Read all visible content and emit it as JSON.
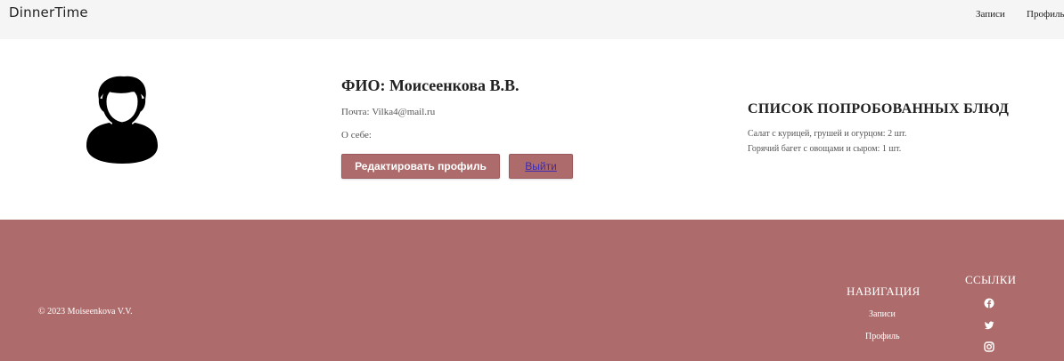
{
  "header": {
    "brand": "DinnerTime",
    "nav": [
      "Записи",
      "Профиль"
    ]
  },
  "profile": {
    "fio": "ФИО: Моисеенкова В.В.",
    "email": "Почта: Vilka4@mail.ru",
    "about": "О себе:",
    "edit_button": "Редактировать профиль",
    "logout_button": "Выйти"
  },
  "dishes": {
    "title": "СПИСОК ПОПРОБОВАННЫХ БЛЮД",
    "items": [
      "Салат с курицей, грушей и огурцом: 2 шт.",
      "Горячий багет с овощами и сыром: 1 шт."
    ]
  },
  "footer": {
    "copyright": "© 2023 Moiseenkova V.V.",
    "nav_title": "НАВИГАЦИЯ",
    "nav_links": [
      "Записи",
      "Профиль"
    ],
    "links_title": "ССЫЛКИ",
    "social_icons": [
      "facebook-icon",
      "twitter-icon",
      "instagram-icon"
    ]
  },
  "colors": {
    "accent": "#ad6b6c",
    "navbar_bg": "#f5f5f5",
    "logout_link": "#3b2bb3"
  }
}
